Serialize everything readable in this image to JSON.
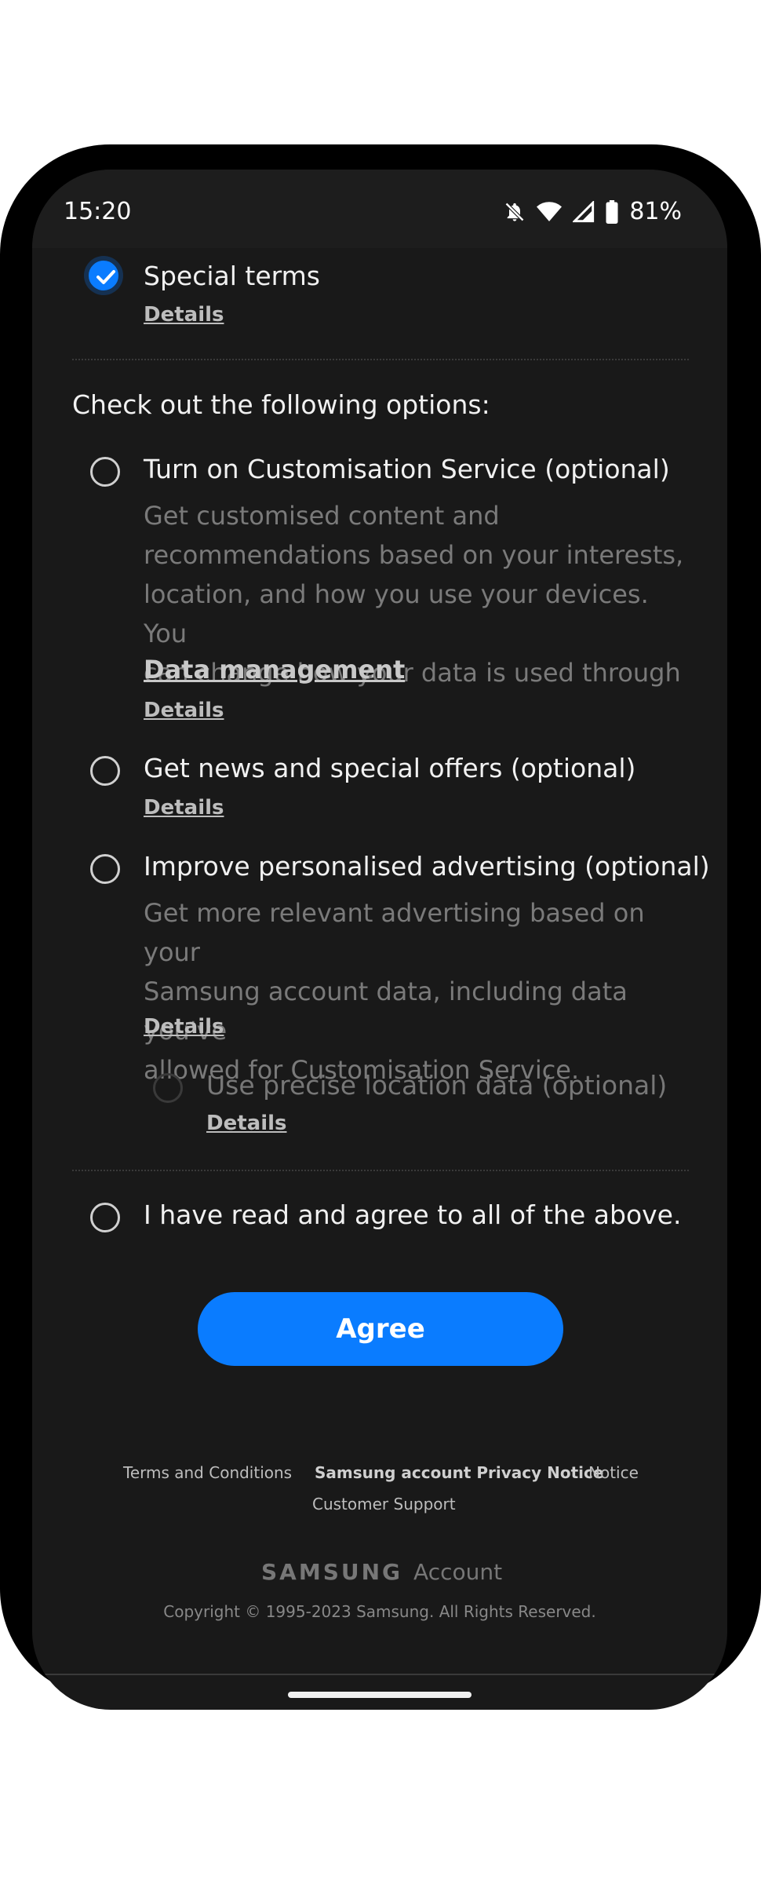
{
  "status_bar": {
    "time": "15:20",
    "battery": "81%",
    "icons": [
      "notifications-off-icon",
      "wifi-icon",
      "signal-icon",
      "battery-icon"
    ]
  },
  "special_terms": {
    "label": "Special terms",
    "details": "Details",
    "checked": true
  },
  "options_title": "Check out the following options:",
  "options": {
    "customisation": {
      "label": "Turn on Customisation Service (optional)",
      "desc_1": "Get customised content and",
      "desc_2": "recommendations based on your interests,",
      "desc_3": "location, and how you use your devices. You",
      "desc_4": "can change how your data is used through",
      "link": "Data management",
      "link_suffix": ".",
      "details": "Details"
    },
    "news": {
      "label": "Get news and special offers (optional)",
      "details": "Details"
    },
    "advertising": {
      "label": "Improve personalised advertising (optional)",
      "desc_1": "Get more relevant advertising based on your",
      "desc_2": "Samsung account data, including data you've",
      "desc_3": "allowed for Customisation Service.",
      "details": "Details"
    },
    "location": {
      "label": "Use precise location data (optional)",
      "details": "Details"
    }
  },
  "agree_all": "I have read and agree to all of the above.",
  "agree_button": "Agree",
  "footer": {
    "terms": "Terms and Conditions",
    "privacy": "Samsung account Privacy Notice",
    "notice": "Notice",
    "support": "Customer Support",
    "brand": "SAMSUNG",
    "brand_suffix": "Account",
    "copyright": "Copyright © 1995-2023 Samsung. All Rights Reserved."
  },
  "colors": {
    "accent": "#0a7cff",
    "background": "#191919"
  }
}
